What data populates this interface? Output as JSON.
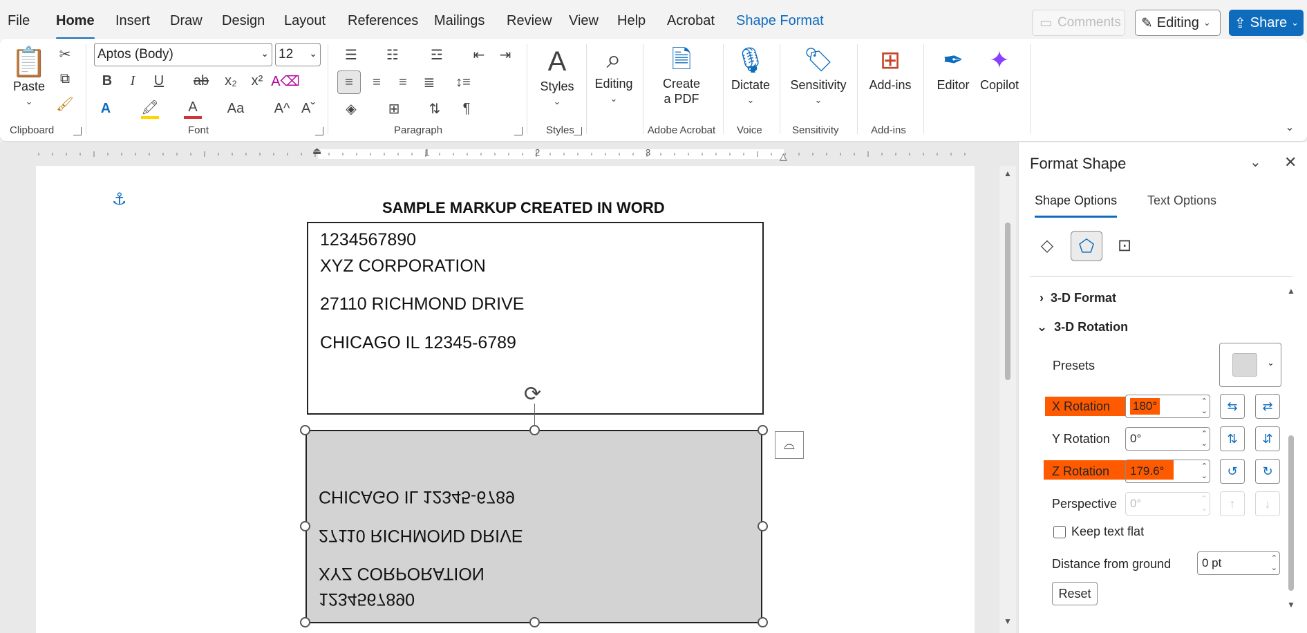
{
  "menubar": {
    "tabs": [
      "File",
      "Home",
      "Insert",
      "Draw",
      "Design",
      "Layout",
      "References",
      "Mailings",
      "Review",
      "View",
      "Help",
      "Acrobat",
      "Shape Format"
    ],
    "comments_label": "Comments",
    "editing_label": "Editing",
    "share_label": "Share"
  },
  "ribbon": {
    "clipboard": {
      "paste": "Paste",
      "label": "Clipboard"
    },
    "font": {
      "name": "Aptos (Body)",
      "size": "12",
      "label": "Font",
      "bold": "B",
      "italic": "I",
      "underline": "U",
      "strike": "ab",
      "sub": "x₂",
      "sup": "x²",
      "grow": "A^",
      "shrink": "Aˇ",
      "case": "Aa"
    },
    "paragraph": {
      "label": "Paragraph"
    },
    "styles": {
      "btn": "Styles",
      "label": "Styles"
    },
    "editing": {
      "btn": "Editing"
    },
    "adobe": {
      "btn_line1": "Create",
      "btn_line2": "a PDF",
      "label": "Adobe Acrobat"
    },
    "voice": {
      "btn": "Dictate",
      "label": "Voice"
    },
    "sensitivity": {
      "btn": "Sensitivity",
      "label": "Sensitivity"
    },
    "addins": {
      "btn": "Add-ins",
      "label": "Add-ins"
    },
    "editor": {
      "btn": "Editor"
    },
    "copilot": {
      "btn": "Copilot"
    }
  },
  "ruler": {
    "marks": [
      "1",
      "2",
      "3"
    ]
  },
  "document": {
    "title": "SAMPLE MARKUP CREATED IN WORD",
    "box1": [
      "1234567890",
      "XYZ CORPORATION",
      "27110 RICHMOND DRIVE",
      "CHICAGO IL 12345-6789"
    ],
    "box2_flipped": [
      "CHICAGO IL 12345-6789",
      "27110 RICHMOND DRIVE",
      "XYZ CORPORATION",
      "1234567890"
    ]
  },
  "pane": {
    "title": "Format Shape",
    "tabs": [
      "Shape Options",
      "Text Options"
    ],
    "sections": {
      "format3d": "3-D Format",
      "rotation3d": "3-D Rotation"
    },
    "presets_label": "Presets",
    "x_rotation": {
      "label": "X Rotation",
      "value": "180°"
    },
    "y_rotation": {
      "label": "Y Rotation",
      "value": "0°"
    },
    "z_rotation": {
      "label": "Z Rotation",
      "value": "179.6°"
    },
    "perspective": {
      "label": "Perspective",
      "value": "0°"
    },
    "keep_flat": "Keep text flat",
    "distance": {
      "label": "Distance from ground",
      "value": "0 pt"
    },
    "reset": "Reset"
  },
  "colors": {
    "accent": "#0f6cbd",
    "highlight": "#ff5a00",
    "shape_fill": "#d3d3d3"
  }
}
